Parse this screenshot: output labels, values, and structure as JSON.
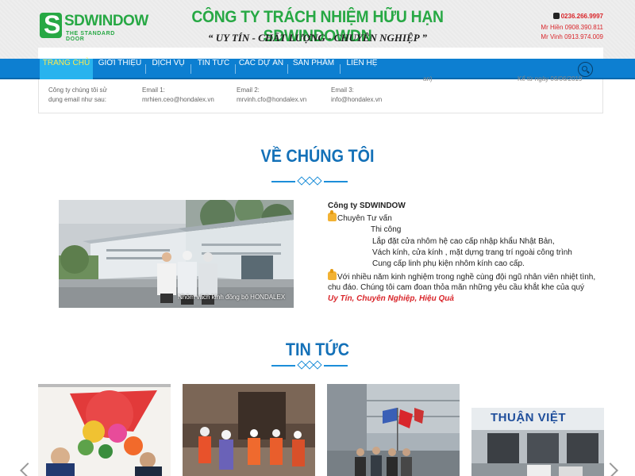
{
  "header": {
    "logo_text": "SDWINDOW",
    "logo_sub": "THE STANDARD DOOR",
    "company_title": "CÔNG TY TRÁCH NHIỆM HỮU HẠN SDWINDOWDN",
    "slogan": "“ UY TÍN - CHẤT LƯỢNG - CHUYÊN NGHIỆP ”",
    "phone_main": "0236.266.9997",
    "phone_1": "Mr Hiền 0908.390.811",
    "phone_2": "Mr Vinh 0913.974.009"
  },
  "nav": {
    "items": [
      {
        "label": "TRANG CHỦ",
        "active": true
      },
      {
        "label": "GIỚI THIỆU"
      },
      {
        "label": "DỊCH VỤ"
      },
      {
        "label": "TIN TỨC"
      },
      {
        "label": "CÁC DỰ ÁN"
      },
      {
        "label": "SẢN PHẨM"
      },
      {
        "label": "LIÊN HỆ"
      }
    ]
  },
  "info_bar": {
    "col1": "Công ty chúng tôi sử",
    "col1b": "dụng email như sau:",
    "email1_label": "Email 1:",
    "email1": "mrhien.ceo@hondalex.vn",
    "email2_label": "Email 2:",
    "email2": "mrvinh.cfo@hondalex.vn",
    "email3_label": "Email 3:",
    "email3": "info@hondalex.vn",
    "cut1": "an)",
    "cut2": "Kể từ ngày 06/06/2019"
  },
  "about": {
    "title": "VỀ CHÚNG TÔI",
    "photo_caption": "Nhôm vách kính đồng bộ HONDALEX",
    "company": "Công ty SDWINDOW",
    "line1": "Chuyên Tư vấn",
    "line2": "Thi công",
    "line3": "Lắp đặt cửa nhôm hệ cao cấp nhập khẩu Nhật Bản,",
    "line4": "Vách kính, cửa kính , mặt dựng trang trí ngoài công trình",
    "line5": "Cung cấp linh phụ kiện nhôm kính cao cấp.",
    "line6": "Với nhiều năm kinh nghiệm trong nghề cùng đội ngũ nhân viên nhiệt tình,",
    "line7": "chu đáo. Chúng tôi cam đoan thỏa mãn những yêu cầu khắt khe của quý",
    "highlight": "Uy Tín, Chuyên Nghiệp, Hiệu Quả"
  },
  "news": {
    "title": "TIN TỨC",
    "card4_sign": "THUẬN VIỆT"
  },
  "colors": {
    "brand_green": "#27a844",
    "nav_blue": "#0d7fd1",
    "heading_blue": "#1471b8",
    "accent_red": "#d9252a"
  }
}
